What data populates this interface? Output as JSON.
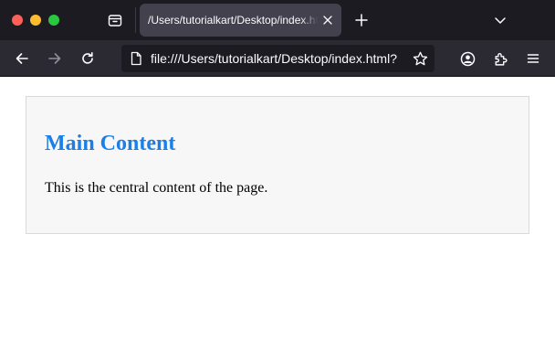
{
  "window": {
    "controls": [
      "close",
      "minimize",
      "zoom"
    ]
  },
  "tabbar": {
    "active_tab_title": "/Users/tutorialkart/Desktop/index.html",
    "icons": {
      "tabs_list": "tab-overview-icon",
      "close_tab": "close-icon",
      "new_tab": "plus-icon",
      "list_all_tabs": "chevron-down-icon"
    }
  },
  "toolbar": {
    "url": "file:///Users/tutorialkart/Desktop/index.html?",
    "icons": [
      "back-icon",
      "forward-icon",
      "reload-icon",
      "page-icon",
      "bookmark-star-icon",
      "account-icon",
      "extensions-icon",
      "menu-icon"
    ]
  },
  "page": {
    "heading": "Main Content",
    "paragraph": "This is the central content of the page."
  },
  "colors": {
    "titlebar": "#1c1b22",
    "toolbar": "#2b2a33",
    "active_tab": "#42414d",
    "heading": "#1a7fe8",
    "content_background": "#f7f7f7"
  }
}
